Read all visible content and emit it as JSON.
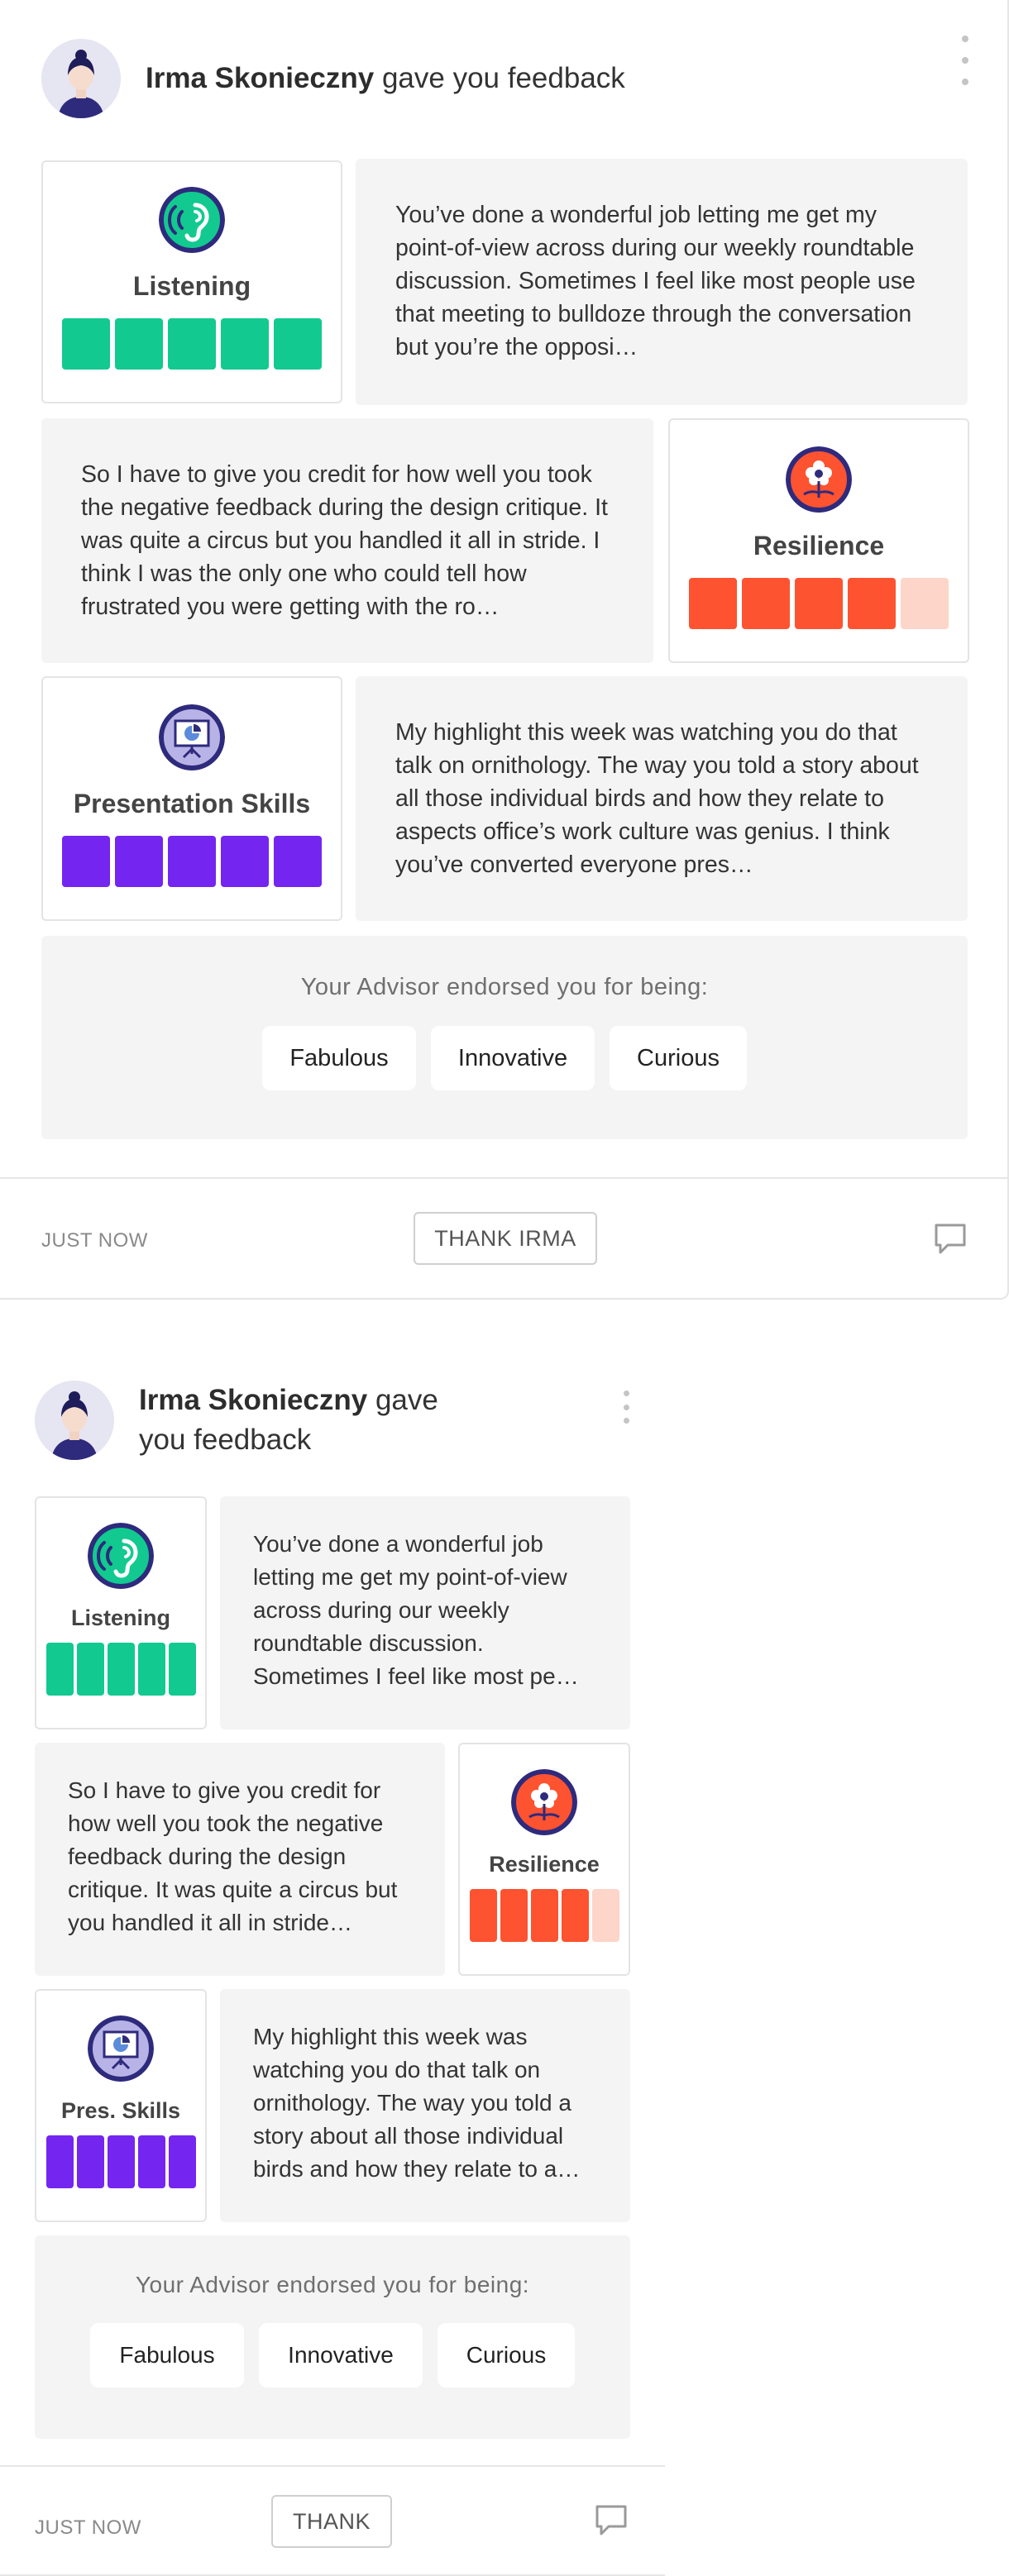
{
  "colors": {
    "listening": "#12c990",
    "resilience": "#fd5330",
    "resilience_empty": "#fdd5c9",
    "presentation": "#7425f0",
    "icon_ring": "#2e2a7c"
  },
  "cards": [
    {
      "header": {
        "name": "Irma Skonieczny",
        "action": " gave you feedback"
      },
      "skills": [
        {
          "label": "Listening",
          "icon": "ear-icon",
          "score": 5,
          "max": 5
        },
        {
          "label": "Resilience",
          "icon": "flower-icon",
          "score": 4,
          "max": 5
        },
        {
          "label": "Presentation Skills",
          "icon": "presentation-board-icon",
          "score": 5,
          "max": 5
        }
      ],
      "quotes": [
        "You’ve done a wonderful job letting me get my point-of-view across during our weekly roundtable discussion. Sometimes I feel like most people use that meeting to bulldoze through the conversation but you’re the opposi…",
        "So I have to give you credit for how well you took the negative feedback during the design critique. It was quite a circus but you handled it all in stride. I think I was the only one who could tell how frustrated you were getting with the ro…",
        "My highlight this week was watching you do that talk on ornithology. The way you told a story about all those individual birds and how they relate to aspects office’s work culture was genius. I think you’ve converted everyone pres…"
      ],
      "endorse": {
        "title": "Your Advisor endorsed you for being:",
        "chips": [
          "Fabulous",
          "Innovative",
          "Curious"
        ]
      },
      "footer": {
        "time": "JUST NOW",
        "thank_label": "THANK IRMA"
      }
    },
    {
      "header": {
        "name": "Irma Skonieczny",
        "action": " gave you feedback"
      },
      "skills": [
        {
          "label": "Listening",
          "icon": "ear-icon",
          "score": 5,
          "max": 5
        },
        {
          "label": "Resilience",
          "icon": "flower-icon",
          "score": 4,
          "max": 5
        },
        {
          "label": "Pres. Skills",
          "icon": "presentation-board-icon",
          "score": 5,
          "max": 5
        }
      ],
      "quotes": [
        "You’ve done a wonderful job letting me get my point-of-view across during our weekly roundtable discussion. Sometimes I feel like most pe…",
        "So I have to give you credit for how well you took the negative feedback during the design critique. It was quite a circus but you handled it all in stride…",
        "My highlight this week was watching you do that talk on ornithology. The way you told a story about all those individual birds and how they relate to a…"
      ],
      "endorse": {
        "title": "Your Advisor endorsed you for being:",
        "chips": [
          "Fabulous",
          "Innovative",
          "Curious"
        ]
      },
      "footer": {
        "time": "JUST NOW",
        "thank_label": "THANK"
      }
    }
  ]
}
